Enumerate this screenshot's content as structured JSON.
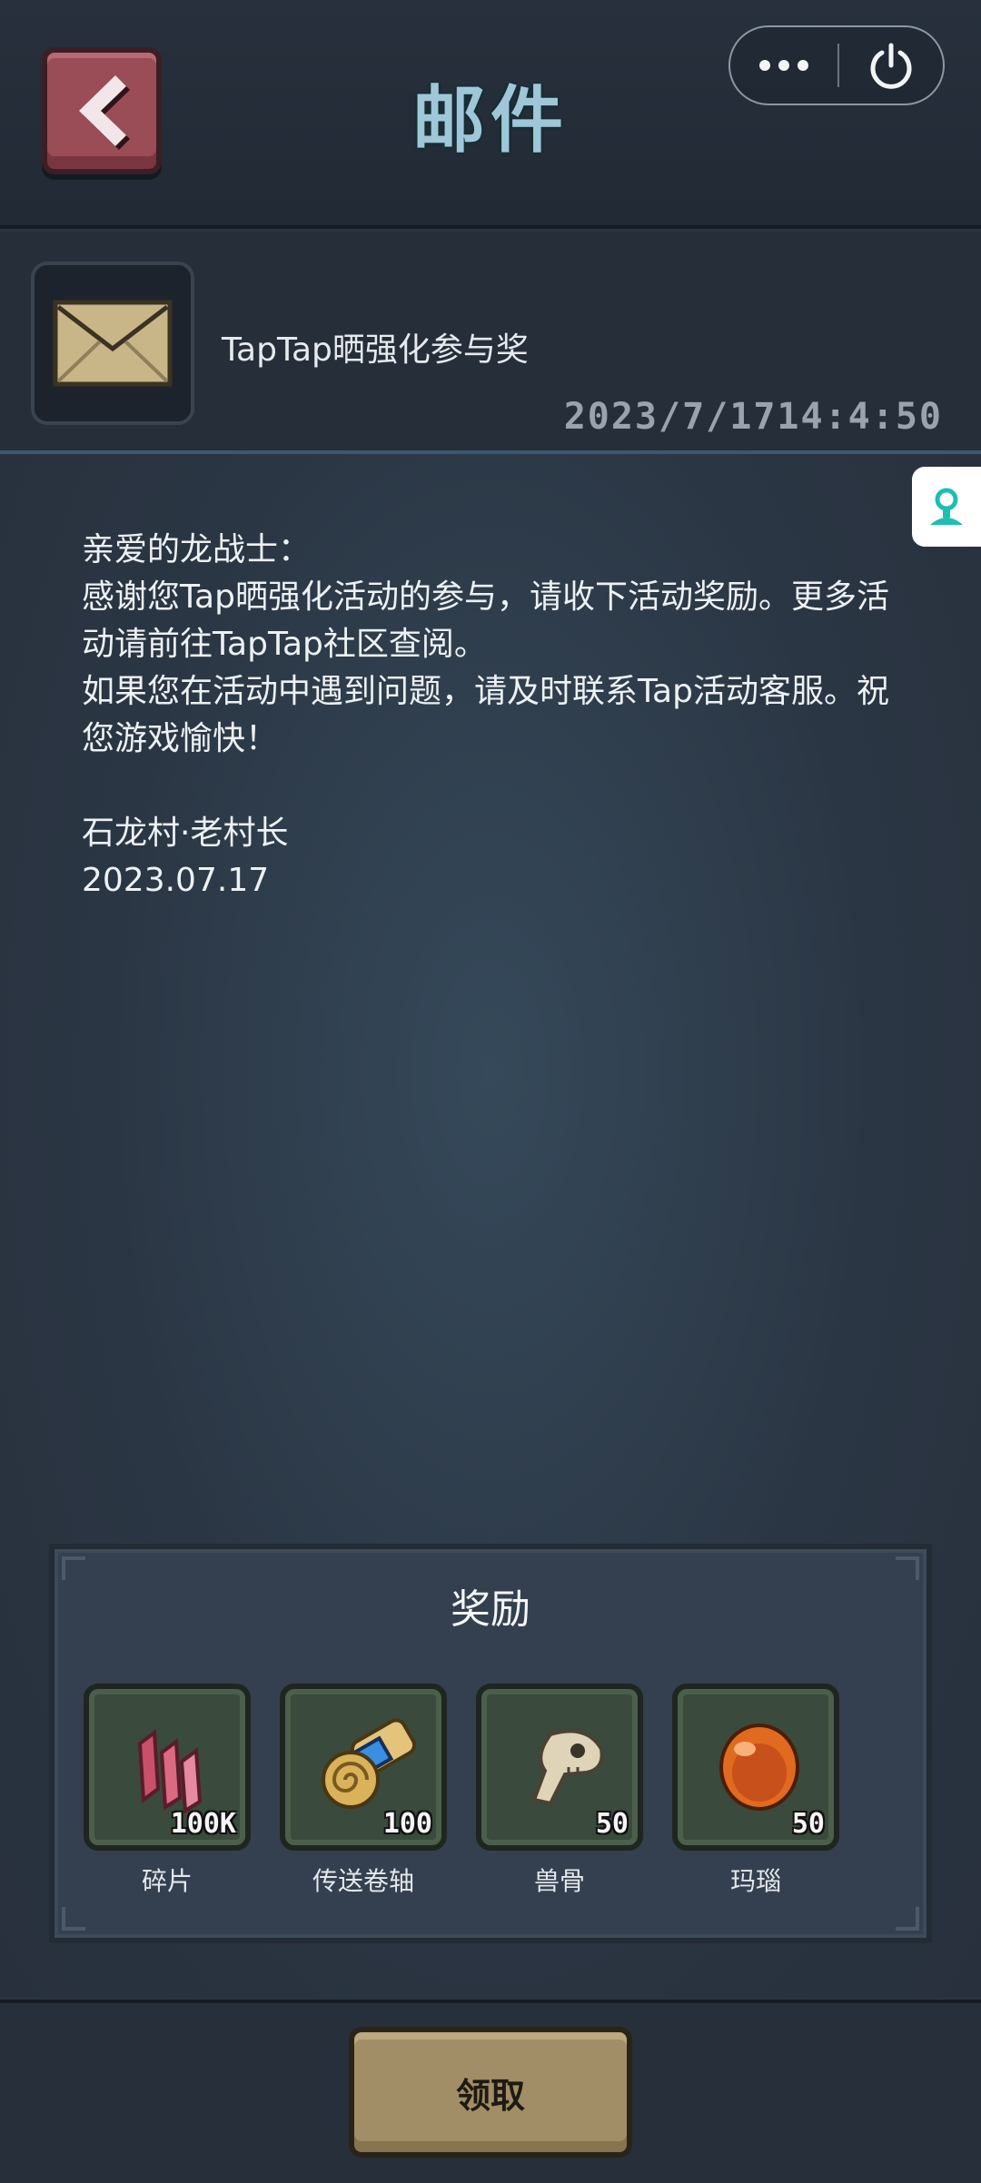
{
  "header": {
    "title": "邮件",
    "back_icon": "chevron-left-icon",
    "capsule": {
      "more_icon": "more-dots-icon",
      "power_icon": "power-icon"
    }
  },
  "mail": {
    "icon": "envelope-icon",
    "subject": "TapTap晒强化参与奖",
    "date": "2023/7/1714:4:50",
    "body": [
      "亲爱的龙战士：",
      "感谢您Tap晒强化活动的参与，请收下活动奖励。更多活动请前往TapTap社区查阅。",
      "如果您在活动中遇到问题，请及时联系Tap活动客服。祝您游戏愉快！"
    ],
    "signature": "石龙村·老村长",
    "signature_date": "2023.07.17"
  },
  "support_tab": {
    "icon": "support-agent-icon"
  },
  "rewards": {
    "title": "奖励",
    "items": [
      {
        "name": "碎片",
        "qty": "100K",
        "icon": "crystal-shard-icon"
      },
      {
        "name": "传送卷轴",
        "qty": "100",
        "icon": "scroll-icon"
      },
      {
        "name": "兽骨",
        "qty": "50",
        "icon": "beast-skull-icon"
      },
      {
        "name": "玛瑙",
        "qty": "50",
        "icon": "agate-icon"
      }
    ]
  },
  "footer": {
    "claim_label": "领取"
  },
  "colors": {
    "back_button": "#9a4d56",
    "title": "#9ec8d8",
    "claim_button": "#a18e66",
    "support_icon": "#1dbfb3"
  }
}
